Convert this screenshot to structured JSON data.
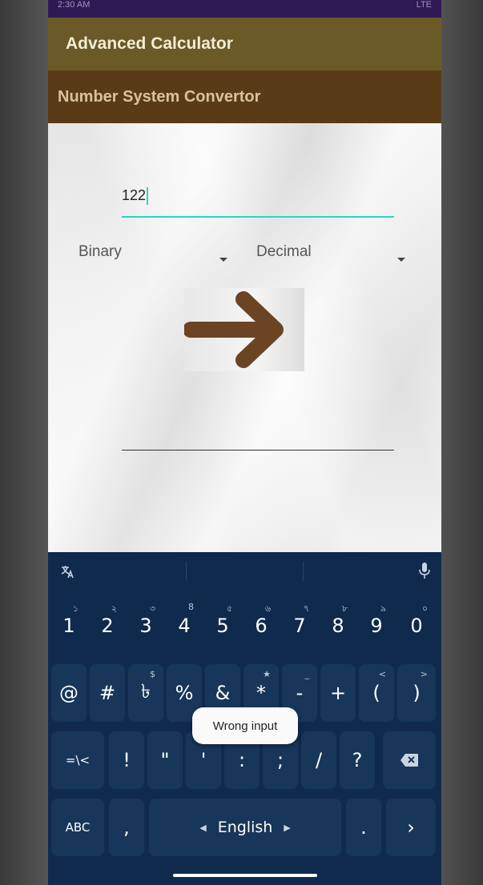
{
  "status_bar": {
    "left": "2:30 AM",
    "right": "LTE"
  },
  "app_bar": {
    "title": "Advanced Calculator"
  },
  "sub_bar": {
    "title": "Number System Convertor"
  },
  "converter": {
    "input_value": "122",
    "from_spinner": "Binary",
    "to_spinner": "Decimal",
    "result_value": ""
  },
  "colors": {
    "accent_teal": "#2bd4c8",
    "arrow_brown": "#6b4424",
    "app_bar": "#6b5a28",
    "sub_bar": "#5a3b17",
    "keyboard_bg": "#0f2a4d"
  },
  "keyboard": {
    "number_row": [
      {
        "label": "1",
        "hint": "১"
      },
      {
        "label": "2",
        "hint": "২"
      },
      {
        "label": "3",
        "hint": "৩"
      },
      {
        "label": "4",
        "hint": "8"
      },
      {
        "label": "5",
        "hint": "৫"
      },
      {
        "label": "6",
        "hint": "৬"
      },
      {
        "label": "7",
        "hint": "৭"
      },
      {
        "label": "8",
        "hint": "৮"
      },
      {
        "label": "9",
        "hint": "৯"
      },
      {
        "label": "0",
        "hint": "০"
      }
    ],
    "symbol_row": [
      {
        "label": "@",
        "hint": ""
      },
      {
        "label": "#",
        "hint": ""
      },
      {
        "label": "৳",
        "hint": "$"
      },
      {
        "label": "%",
        "hint": ""
      },
      {
        "label": "&",
        "hint": ""
      },
      {
        "label": "*",
        "hint": "★"
      },
      {
        "label": "-",
        "hint": "_"
      },
      {
        "label": "+",
        "hint": ""
      },
      {
        "label": "(",
        "hint": "<"
      },
      {
        "label": ")",
        "hint": ">"
      }
    ],
    "punct_row": [
      {
        "label": "=\\<"
      },
      {
        "label": "!"
      },
      {
        "label": "\""
      },
      {
        "label": "'"
      },
      {
        "label": ":"
      },
      {
        "label": ";"
      },
      {
        "label": "/"
      },
      {
        "label": "?"
      }
    ],
    "bottom_row": {
      "abc": "ABC",
      "comma": ",",
      "space": "English",
      "period": ".",
      "enter": "›"
    }
  },
  "toast": {
    "message": "Wrong input"
  }
}
